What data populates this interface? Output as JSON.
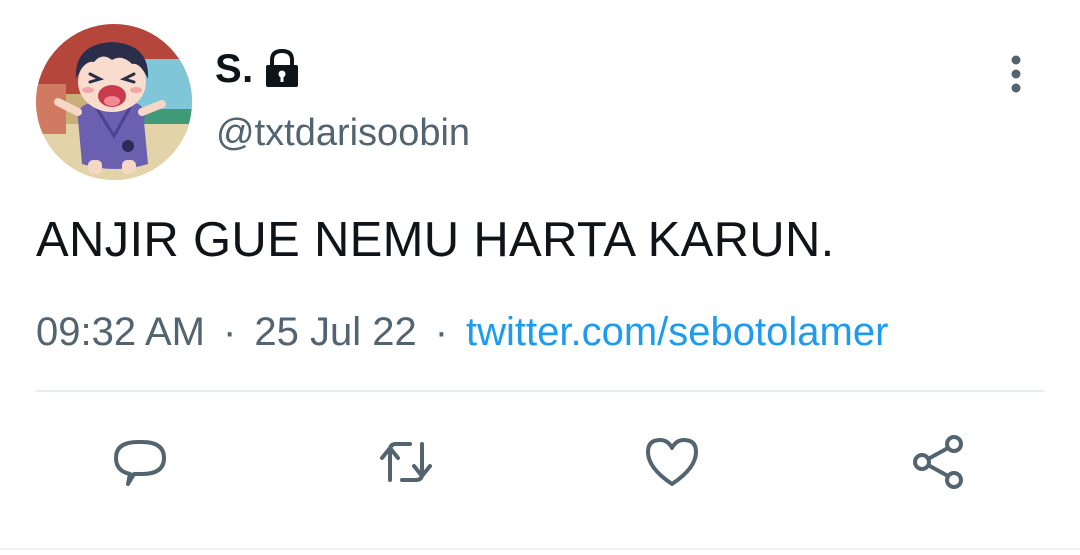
{
  "author": {
    "display_name": "S.",
    "handle": "@txtdarisoobin",
    "protected_icon": "lock-icon",
    "avatar_icon": "cartoon-child-avatar"
  },
  "tweet": {
    "text": "ANJIR GUE NEMU HARTA KARUN.",
    "time": "09:32 AM",
    "separator": "·",
    "date": "25 Jul 22",
    "source_link": "twitter.com/sebotolamer"
  },
  "actions": {
    "more_icon": "more-vertical-icon",
    "reply_icon": "reply-icon",
    "retweet_icon": "retweet-icon",
    "like_icon": "heart-icon",
    "share_icon": "share-icon"
  },
  "colors": {
    "text_primary": "#0f1419",
    "text_secondary": "#536471",
    "link": "#1d9bf0",
    "divider": "#e6ecf0"
  }
}
